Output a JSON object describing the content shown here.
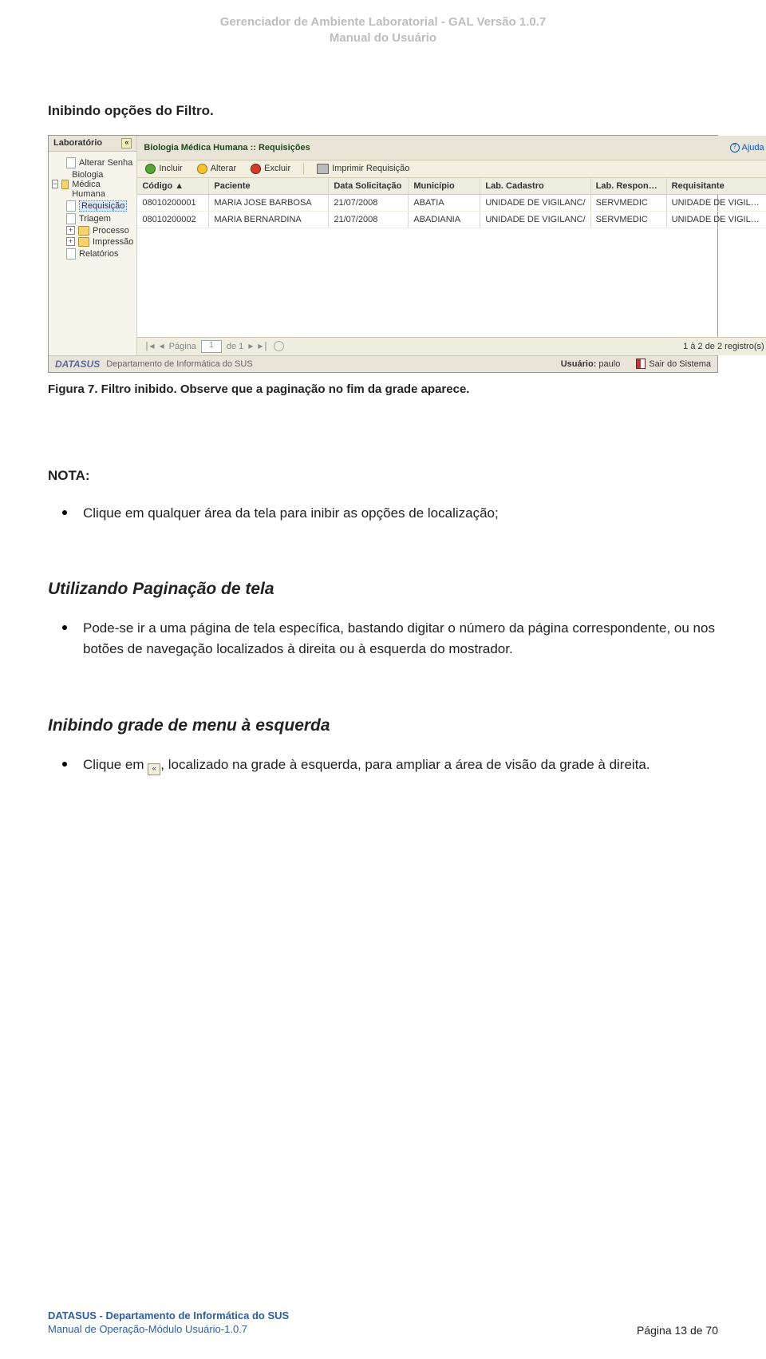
{
  "header": {
    "line1": "Gerenciador de Ambiente Laboratorial - GAL Versão 1.0.7",
    "line2": "Manual do Usuário"
  },
  "section1_title": "Inibindo opções do Filtro.",
  "screenshot": {
    "side_header": "Laboratório",
    "tree": {
      "alterar_senha": "Alterar Senha",
      "root": "Biologia Médica Humana",
      "requisicao": "Requisição",
      "triagem": "Triagem",
      "processo": "Processo",
      "impressao": "Impressão",
      "relatorios": "Relatórios"
    },
    "breadcrumb": "Biologia Médica Humana :: Requisições",
    "ajuda": "Ajuda",
    "toolbar": {
      "incluir": "Incluir",
      "alterar": "Alterar",
      "excluir": "Excluir",
      "imprimir": "Imprimir Requisição"
    },
    "columns": {
      "codigo": "Código ▲",
      "paciente": "Paciente",
      "data": "Data Solicitação",
      "municipio": "Município",
      "labcad": "Lab. Cadastro",
      "labresp": "Lab. Responsável",
      "requisitante": "Requisitante"
    },
    "rows": [
      {
        "codigo": "08010200001",
        "paciente": "MARIA JOSE BARBOSA",
        "data": "21/07/2008",
        "municipio": "ABATIA",
        "labcad": "UNIDADE DE VIGILANC/",
        "labresp": "SERVMEDIC",
        "req": "UNIDADE DE VIGILANC/"
      },
      {
        "codigo": "08010200002",
        "paciente": "MARIA BERNARDINA",
        "data": "21/07/2008",
        "municipio": "ABADIANIA",
        "labcad": "UNIDADE DE VIGILANC/",
        "labresp": "SERVMEDIC",
        "req": "UNIDADE DE VIGILANC/"
      }
    ],
    "pager": {
      "pagina_word": "Página",
      "page_value": "1",
      "de_word": "de 1",
      "status": "1 à 2 de 2 registro(s)"
    },
    "footer": {
      "logo": "DATASUS",
      "dept": "Departamento de Informática do SUS",
      "usuario_label": "Usuário: ",
      "usuario_name": "paulo",
      "sair": "Sair do Sistema"
    }
  },
  "caption": "Figura 7. Filtro inibido. Observe que a paginação no fim da grade aparece.",
  "nota_label": "NOTA:",
  "nota_bullet": "Clique em qualquer área da tela para inibir as opções de localização;",
  "section2_title": "Utilizando Paginação de tela",
  "paginacao_bullet": "Pode-se ir a uma página de tela específica, bastando digitar o número da página correspondente, ou nos botões de navegação localizados à direita ou à esquerda do mostrador.",
  "section3_title": "Inibindo grade de menu à esquerda",
  "inibindo_prefix": "Clique em ",
  "inibindo_icon_glyph": "«",
  "inibindo_suffix": ", localizado na grade à esquerda, para ampliar a área de visão da grade à direita.",
  "footer": {
    "org": "DATASUS - Departamento de Informática do SUS",
    "doc": "Manual de Operação-Módulo Usuário-1.0.7",
    "page": "Página 13 de 70"
  }
}
